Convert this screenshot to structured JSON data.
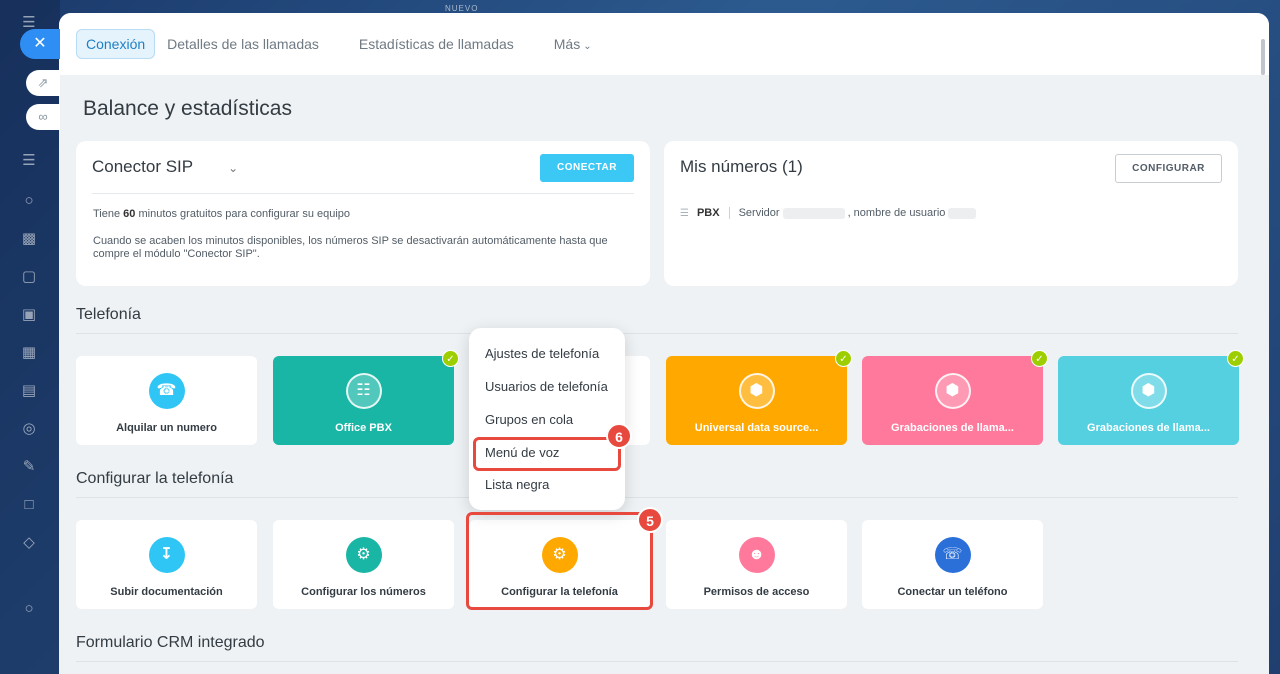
{
  "background": {
    "label": "NUEVO",
    "sidebar_icons": [
      "task-icon",
      "cart-icon",
      "chart-icon"
    ]
  },
  "tabs": [
    {
      "label": "Conexión",
      "active": true
    },
    {
      "label": "Detalles de las llamadas",
      "active": false
    },
    {
      "label": "Estadísticas de llamadas",
      "active": false
    },
    {
      "label": "Más",
      "active": false
    }
  ],
  "page_title": "Balance y estadísticas",
  "sip_card": {
    "title": "Conector SIP",
    "button": "CONECTAR",
    "text_before": "Tiene ",
    "minutes": "60",
    "text_after": " minutos gratuitos para configurar su equipo",
    "description": "Cuando se acaben los minutos disponibles, los números SIP se desactivarán automáticamente hasta que compre el módulo \"Conector SIP\"."
  },
  "numbers_card": {
    "title": "Mis números (1)",
    "button": "CONFIGURAR",
    "pbx_label": "PBX",
    "server_label": "Servidor",
    "user_label": ", nombre de usuario"
  },
  "telefonia": {
    "title": "Telefonía",
    "tiles": [
      {
        "label": "Alquilar un numero",
        "style": "white",
        "color": "#2fc6f6",
        "icon": "phone-dollar-icon",
        "installed": false
      },
      {
        "label": "Office PBX",
        "style": "colored",
        "color": "#19b5a5",
        "icon": "pbx-icon",
        "installed": true
      },
      {
        "label": "Universal data source...",
        "style": "colored",
        "color": "#ffa900",
        "icon": "box-icon",
        "installed": true
      },
      {
        "label": "Grabaciones de llama...",
        "style": "colored",
        "color": "#ff799c",
        "icon": "box-icon",
        "installed": true
      },
      {
        "label": "Grabaciones de llama...",
        "style": "colored",
        "color": "#55d0e0",
        "icon": "box-icon",
        "installed": true
      }
    ]
  },
  "popup_menu": {
    "items": [
      "Ajustes de telefonía",
      "Usuarios de telefonía",
      "Grupos en cola",
      "Menú de voz",
      "Lista negra"
    ],
    "highlighted": "Menú de voz"
  },
  "configurar": {
    "title": "Configurar la telefonía",
    "tiles": [
      {
        "label": "Subir documentación",
        "color": "#2fc6f6",
        "icon": "upload-document-icon"
      },
      {
        "label": "Configurar los números",
        "color": "#19b5a5",
        "icon": "phone-gear-icon"
      },
      {
        "label": "Configurar la telefonía",
        "color": "#ffa900",
        "icon": "settings-sliders-icon"
      },
      {
        "label": "Permisos de acceso",
        "color": "#ff799c",
        "icon": "user-lock-icon"
      },
      {
        "label": "Conectar un teléfono",
        "color": "#2b70d9",
        "icon": "phone-plug-icon"
      }
    ]
  },
  "crm_form": {
    "title": "Formulario CRM integrado"
  },
  "annotations": {
    "step5": "5",
    "step6": "6",
    "highlight_color": "#e8493f"
  }
}
